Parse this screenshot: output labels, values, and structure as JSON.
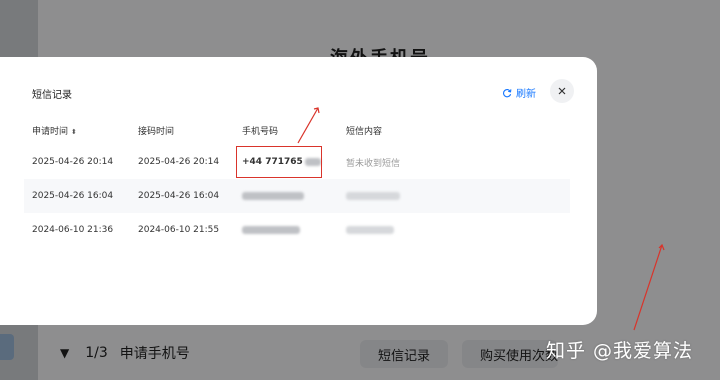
{
  "background": {
    "page_title": "海外手机号",
    "footer": {
      "step": "1/3",
      "label": "申请手机号",
      "sms_button": "短信记录",
      "buy_button": "购买使用次数"
    }
  },
  "modal": {
    "title": "短信记录",
    "refresh_label": "刷新",
    "columns": [
      "申请时间",
      "接码时间",
      "手机号码",
      "短信内容"
    ],
    "rows": [
      {
        "apply_time": "2025-04-26 20:14",
        "receive_time": "2025-04-26 20:14",
        "phone": "+44 771765",
        "sms": "暂未收到短信"
      },
      {
        "apply_time": "2025-04-26 16:04",
        "receive_time": "2025-04-26 16:04",
        "phone": "",
        "sms": ""
      },
      {
        "apply_time": "2024-06-10 21:36",
        "receive_time": "2024-06-10 21:55",
        "phone": "",
        "sms": ""
      }
    ]
  },
  "watermark": "知乎 @我爱算法",
  "colors": {
    "accent": "#1677ff",
    "annotation": "#d9342b"
  }
}
